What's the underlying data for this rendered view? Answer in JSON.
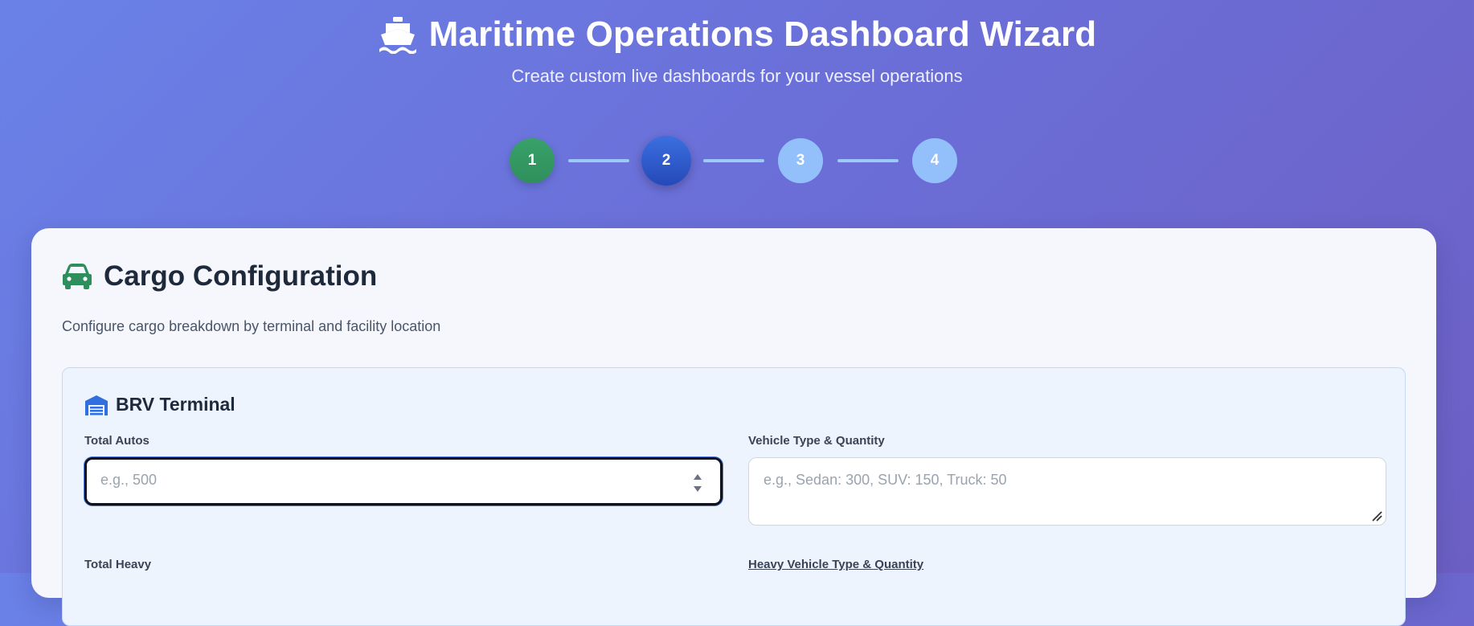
{
  "header": {
    "title": "Maritime Operations Dashboard Wizard",
    "subtitle": "Create custom live dashboards for your vessel operations",
    "icon": "ship-icon"
  },
  "stepper": {
    "steps": [
      {
        "label": "1",
        "state": "completed"
      },
      {
        "label": "2",
        "state": "active"
      },
      {
        "label": "3",
        "state": "upcoming"
      },
      {
        "label": "4",
        "state": "upcoming"
      }
    ]
  },
  "section": {
    "icon": "car-icon",
    "title": "Cargo Configuration",
    "description": "Configure cargo breakdown by terminal and facility location"
  },
  "terminal": {
    "icon": "warehouse-icon",
    "name": "BRV Terminal",
    "fields": {
      "total_autos": {
        "label": "Total Autos",
        "placeholder": "e.g., 500",
        "value": ""
      },
      "vehicle_type_quantity": {
        "label": "Vehicle Type & Quantity",
        "placeholder": "e.g., Sedan: 300, SUV: 150, Truck: 50",
        "value": ""
      },
      "total_heavy": {
        "label": "Total Heavy"
      },
      "heavy_vehicle_type_quantity": {
        "label": "Heavy Vehicle Type & Quantity"
      }
    }
  },
  "colors": {
    "completed": "#38a169",
    "active": "#2f5fd0",
    "upcoming": "#93c0fb",
    "section_icon": "#2f8f5c",
    "terminal_icon": "#2f6fe0"
  }
}
